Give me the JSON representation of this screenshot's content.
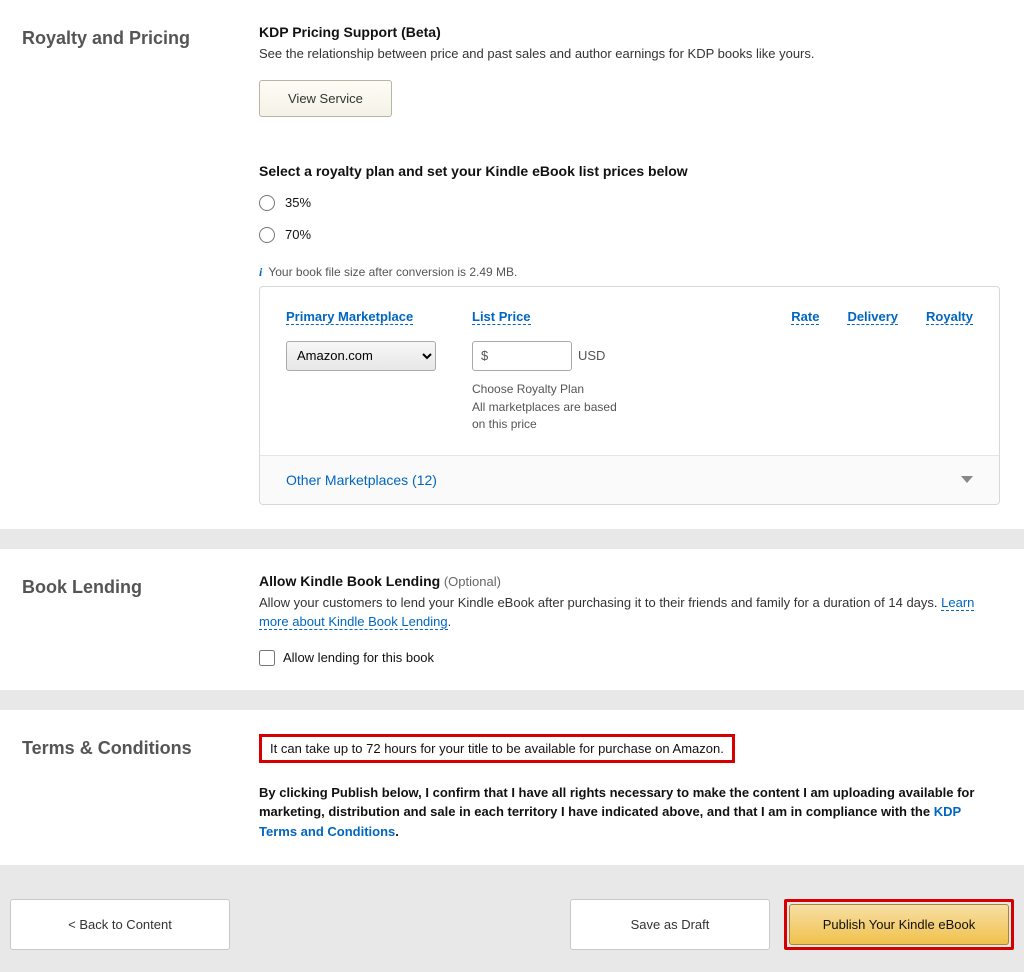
{
  "royalty": {
    "section_title": "Royalty and Pricing",
    "support_title": "KDP Pricing Support (Beta)",
    "support_desc": "See the relationship between price and past sales and author earnings for KDP books like yours.",
    "view_service_btn": "View Service",
    "royalty_plan_heading": "Select a royalty plan and set your Kindle eBook list prices below",
    "option35": "35%",
    "option70": "70%",
    "file_size_info": "Your book file size after conversion is 2.49 MB.",
    "cols": {
      "primary": "Primary Marketplace",
      "list_price": "List Price",
      "rate": "Rate",
      "delivery": "Delivery",
      "royalty": "Royalty"
    },
    "marketplace_selected": "Amazon.com",
    "currency_symbol": "$",
    "currency_code": "USD",
    "list_price_value": "",
    "choose_plan": "Choose Royalty Plan",
    "based_on": "All marketplaces are based on this price",
    "other_marketplaces": "Other Marketplaces (12)"
  },
  "lending": {
    "section_title": "Book Lending",
    "heading": "Allow Kindle Book Lending",
    "optional": "(Optional)",
    "desc_prefix": "Allow your customers to lend your Kindle eBook after purchasing it to their friends and family for a duration of 14 days. ",
    "learn_more": "Learn more about Kindle Book Lending",
    "checkbox_label": "Allow lending for this book"
  },
  "terms": {
    "section_title": "Terms & Conditions",
    "notice": "It can take up to 72 hours for your title to be available for purchase on Amazon.",
    "confirm_text": "By clicking Publish below, I confirm that I have all rights necessary to make the content I am uploading available for marketing, distribution and sale in each territory I have indicated above, and that I am in compliance with the ",
    "link": "KDP Terms and Conditions",
    "period": "."
  },
  "footer": {
    "back": "< Back to Content",
    "save": "Save as Draft",
    "publish": "Publish Your Kindle eBook"
  }
}
